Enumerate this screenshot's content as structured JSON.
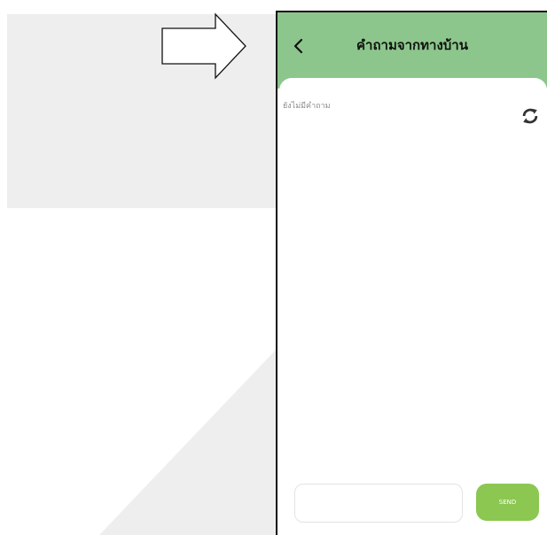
{
  "header": {
    "back_icon": "chevron-left-icon",
    "title": "คำถามจากทางบ้าน"
  },
  "content": {
    "empty_message": "ยังไม่มีคำถาม",
    "refresh_icon": "refresh-icon"
  },
  "composer": {
    "input_value": "",
    "input_placeholder": "",
    "send_label": "SEND"
  },
  "annotation": {
    "arrow_icon": "right-arrow-outline-icon"
  },
  "colors": {
    "header_bg": "#8cc68c",
    "send_bg": "#8cc751",
    "background_gray": "#efeeee"
  }
}
